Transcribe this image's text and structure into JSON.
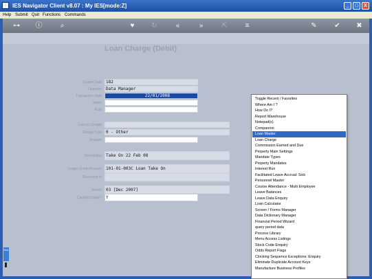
{
  "window": {
    "title": "IES Navigator Client v8.07 : My IES :",
    "mode": "[mode:Z]",
    "controls": [
      "_",
      "□",
      "X"
    ]
  },
  "menubar": [
    "Help",
    "Submit",
    "Quit",
    "Functions",
    "Commands"
  ],
  "toolbar": {
    "icons": [
      "key-icon",
      "info-icon",
      "search-icon",
      "heart-icon",
      "refresh-icon",
      "back-icon",
      "forward-icon",
      "export-icon",
      "list-icon",
      "edit-icon",
      "confirm-icon",
      "cancel-icon"
    ]
  },
  "page": {
    "title": "Loan Charge (Debit)"
  },
  "form": {
    "fields": [
      {
        "label": "System Date",
        "value": "182"
      },
      {
        "label": "Operator",
        "value": "Data Manager"
      },
      {
        "label": "Transaction Date",
        "value": "22/01/2008"
      },
      {
        "label": "Batch",
        "value": ""
      },
      {
        "label": "Auth",
        "value": ""
      },
      {
        "label": "Loan to Charge",
        "value": ""
      },
      {
        "label": "Charge Type",
        "value": "0 - Other"
      },
      {
        "label": "Amount",
        "value": ""
      },
      {
        "label": "Description",
        "value": "Take On 22 Feb 08"
      },
      {
        "label": "Ledger Credit Account",
        "value": "101-01-003C Loan Take On"
      },
      {
        "label": "Document Id",
        "value": ""
      },
      {
        "label": "Period",
        "value": "03  [Dec 2007]"
      },
      {
        "label": "Capital Charge?",
        "value": "Y"
      }
    ]
  },
  "context_menu": {
    "items": [
      "Toggle Recent / Favorites",
      "Where Am I ?",
      "How Do I?",
      "Report Warehouse",
      "Notepad(s)",
      "Companion",
      "Loan Master",
      "Loan Charge",
      "Commission Earned and Due",
      "Property Main Settings",
      "Mandate Types",
      "Property Mandates",
      "Interest Run",
      "Facilitated Leave Accrual: Sick",
      "Personnel Master",
      "Course Attendance - Multi Employee",
      "Leave Balances",
      "Leave Data Enquiry",
      "Loan Calculator",
      "Screen / Forms Manager",
      "Data Dictionary Manager",
      "Financial Period Wizard",
      "query period data",
      "Process Library",
      "Menu Access Listings",
      "Stock Code Enquiry",
      "Odds Report Flags",
      "Clocking Sequence Exceptions: Enquiry",
      "Eliminate Duplicate Account Keys",
      "Manufacture Business Profiles"
    ],
    "highlighted": "Loan Master"
  },
  "side_tab": {
    "label": "Nav"
  }
}
